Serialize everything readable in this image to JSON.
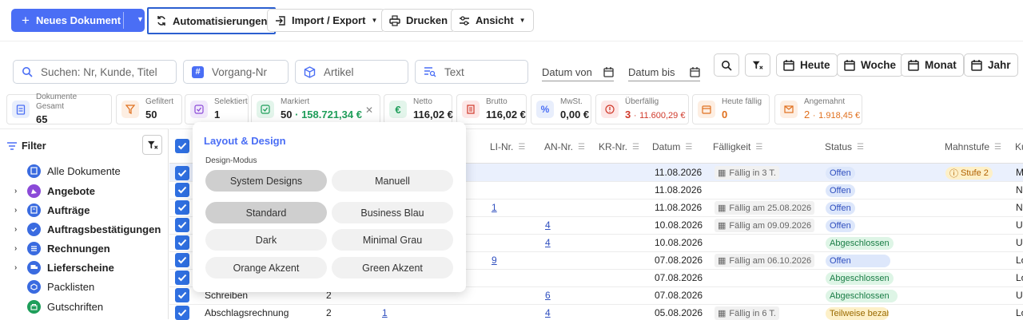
{
  "toolbar": {
    "new_doc": "Neues Dokument",
    "automations": "Automatisierungen",
    "import_export": "Import / Export",
    "print": "Drucken",
    "view": "Ansicht"
  },
  "search": {
    "customer_placeholder": "Suchen: Nr, Kunde, Titel",
    "process_placeholder": "Vorgang-Nr",
    "article_placeholder": "Artikel",
    "text_placeholder": "Text",
    "date_from": "Datum von",
    "date_to": "Datum bis"
  },
  "quick": {
    "today": "Heute",
    "week": "Woche",
    "month": "Monat",
    "year": "Jahr"
  },
  "stats": [
    {
      "label": "Dokumente Gesamt",
      "value": "65",
      "sub": ""
    },
    {
      "label": "Gefiltert",
      "value": "50",
      "sub": ""
    },
    {
      "label": "Selektiert",
      "value": "1",
      "sub": ""
    },
    {
      "label": "Markiert",
      "value": "50",
      "sub": "158.721,34 €"
    },
    {
      "label": "Netto",
      "value": "116,02 €",
      "sub": ""
    },
    {
      "label": "Brutto",
      "value": "116,02 €",
      "sub": ""
    },
    {
      "label": "MwSt.",
      "value": "0,00 €",
      "sub": ""
    },
    {
      "label": "Überfällig",
      "value": "3",
      "sub": "11.600,29 €"
    },
    {
      "label": "Heute fällig",
      "value": "0",
      "sub": ""
    },
    {
      "label": "Angemahnt",
      "value": "2",
      "sub": "1.918,45 €"
    }
  ],
  "sidebar": {
    "title": "Filter",
    "items": [
      {
        "label": "Alle Dokumente"
      },
      {
        "label": "Angebote"
      },
      {
        "label": "Aufträge"
      },
      {
        "label": "Auftragsbestätigungen"
      },
      {
        "label": "Rechnungen"
      },
      {
        "label": "Lieferscheine"
      },
      {
        "label": "Packlisten"
      },
      {
        "label": "Gutschriften"
      }
    ]
  },
  "table": {
    "headers": {
      "li": "LI-Nr.",
      "an": "AN-Nr.",
      "kr": "KR-Nr.",
      "date": "Datum",
      "due": "Fälligkeit",
      "status": "Status",
      "dunning": "Mahnstufe",
      "ku": "Ku"
    },
    "rows": [
      {
        "li": "",
        "an": "",
        "date": "11.08.2026",
        "due": "Fällig in 3 T.",
        "status": "Offen",
        "dunning": "Stufe 2",
        "ku": "M"
      },
      {
        "li": "",
        "an": "",
        "date": "11.08.2026",
        "due": "",
        "status": "Offen",
        "dunning": "",
        "ku": "N"
      },
      {
        "li": "1",
        "an": "",
        "date": "11.08.2026",
        "due": "Fällig am 25.08.2026",
        "status": "Offen",
        "dunning": "",
        "ku": "N"
      },
      {
        "li": "",
        "an": "4",
        "date": "10.08.2026",
        "due": "Fällig am 09.09.2026",
        "status": "Offen",
        "dunning": "",
        "ku": "U"
      },
      {
        "li": "",
        "an": "4",
        "date": "10.08.2026",
        "due": "",
        "status": "Abgeschlossen",
        "dunning": "",
        "ku": "U"
      },
      {
        "li": "9",
        "an": "",
        "date": "07.08.2026",
        "due": "Fällig am 06.10.2026",
        "status": "Offen",
        "dunning": "",
        "ku": "Lo"
      },
      {
        "li": "",
        "an": "",
        "date": "07.08.2026",
        "due": "",
        "status": "Abgeschlossen",
        "dunning": "",
        "ku": "Lo"
      },
      {
        "li": "",
        "an": "6",
        "date": "07.08.2026",
        "due": "",
        "status": "Abgeschlossen",
        "dunning": "",
        "ku": "U"
      },
      {
        "li": "",
        "an": "4",
        "date": "05.08.2026",
        "due": "Fällig in 6 T.",
        "status": "Teilweise bezahlt",
        "dunning": "",
        "ku": "Lo"
      }
    ],
    "type_rows": [
      {
        "label": "Schreiben",
        "count": "2",
        "li": ""
      },
      {
        "label": "Abschlagsrechnung",
        "count": "2",
        "li": "1"
      }
    ]
  },
  "popup": {
    "title": "Layout & Design",
    "mode_label": "Design-Modus",
    "modes": [
      "System Designs",
      "Manuell"
    ],
    "themes": [
      "Standard",
      "Business Blau",
      "Dark",
      "Minimal Grau",
      "Orange Akzent",
      "Green Akzent"
    ]
  },
  "colors": {
    "primary": "#4a6ef5",
    "green": "#1e9e5a",
    "red": "#d03a2b",
    "orange": "#e0701e"
  }
}
